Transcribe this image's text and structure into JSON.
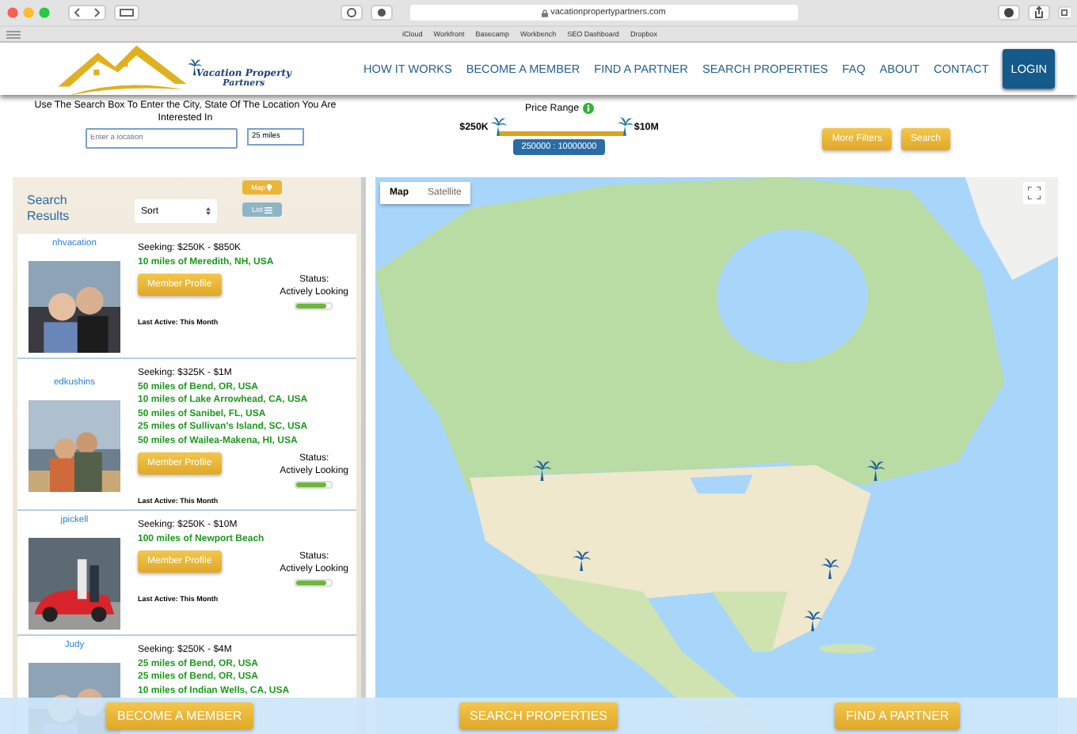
{
  "browser": {
    "url": "vacationpropertypartners.com",
    "bookmarks": [
      "iCloud",
      "Workfront",
      "Basecamp",
      "Workbench",
      "SEO Dashboard",
      "Dropbox"
    ]
  },
  "logo": {
    "line1": "Vacation Property",
    "line2": "Partners"
  },
  "nav": [
    {
      "label": "HOW IT WORKS",
      "kind": "link"
    },
    {
      "label": "BECOME A MEMBER",
      "kind": "link"
    },
    {
      "label": "FIND A PARTNER",
      "kind": "link"
    },
    {
      "label": "SEARCH PROPERTIES",
      "kind": "link"
    },
    {
      "label": "FAQ",
      "kind": "link"
    },
    {
      "label": "ABOUT",
      "kind": "link"
    },
    {
      "label": "CONTACT",
      "kind": "link"
    },
    {
      "label": "LOGIN",
      "kind": "button"
    }
  ],
  "search": {
    "instructions": "Use The Search Box To Enter the City, State Of The Location You Are Interested In",
    "location": {
      "placeholder": "Enter a location"
    },
    "radius": "25 miles"
  },
  "price": {
    "label": "Price Range",
    "min_label": "$250K",
    "max_label": "$10M",
    "value": "250000 : 10000000",
    "low": {
      "level": 0
    },
    "high": {
      "level": 1
    }
  },
  "filters": [
    "More Filters",
    "Search"
  ],
  "results": {
    "title": "Search Results",
    "sort": "Sort",
    "views": [
      {
        "label": "Map",
        "kind": "map",
        "selected": true
      },
      {
        "label": "List",
        "kind": "list",
        "selected": false
      }
    ]
  },
  "members": [
    {
      "name": "nhvacation",
      "seeking": "Seeking: $250K - $850K",
      "locations": [
        "10 miles of Meredith, NH, USA"
      ],
      "button": "Member Profile",
      "status_label": "Status:",
      "status": "Actively Looking",
      "level": 0.85,
      "last_active": "Last Active: This Month"
    },
    {
      "name": "edkushins",
      "seeking": "Seeking: $325K - $1M",
      "locations": [
        "50 miles of Bend, OR, USA",
        "10 miles of Lake Arrowhead, CA, USA",
        "50 miles of Sanibel, FL, USA",
        "25 miles of Sullivan's Island, SC, USA",
        "50 miles of Wailea-Makena, HI, USA"
      ],
      "button": "Member Profile",
      "status_label": "Status:",
      "status": "Actively Looking",
      "level": 0.85,
      "last_active": "Last Active: This Month"
    },
    {
      "name": "jpickell",
      "seeking": "Seeking: $250K - $10M",
      "locations": [
        "100 miles of Newport Beach"
      ],
      "button": "Member Profile",
      "status_label": "Status:",
      "status": "Actively Looking",
      "level": 0.85,
      "last_active": "Last Active: This Month"
    },
    {
      "name": "Judy",
      "seeking": "Seeking: $250K - $4M",
      "locations": [
        "25 miles of Bend, OR, USA",
        "25 miles of Bend, OR, USA",
        "10 miles of Indian Wells, CA, USA"
      ]
    }
  ],
  "map": {
    "kind": "picture",
    "types": [
      {
        "label": "Map",
        "selected": true
      },
      {
        "label": "Satellite",
        "selected": false
      }
    ]
  },
  "bottom_buttons": [
    "BECOME A MEMBER",
    "SEARCH PROPERTIES",
    "FIND A PARTNER"
  ]
}
